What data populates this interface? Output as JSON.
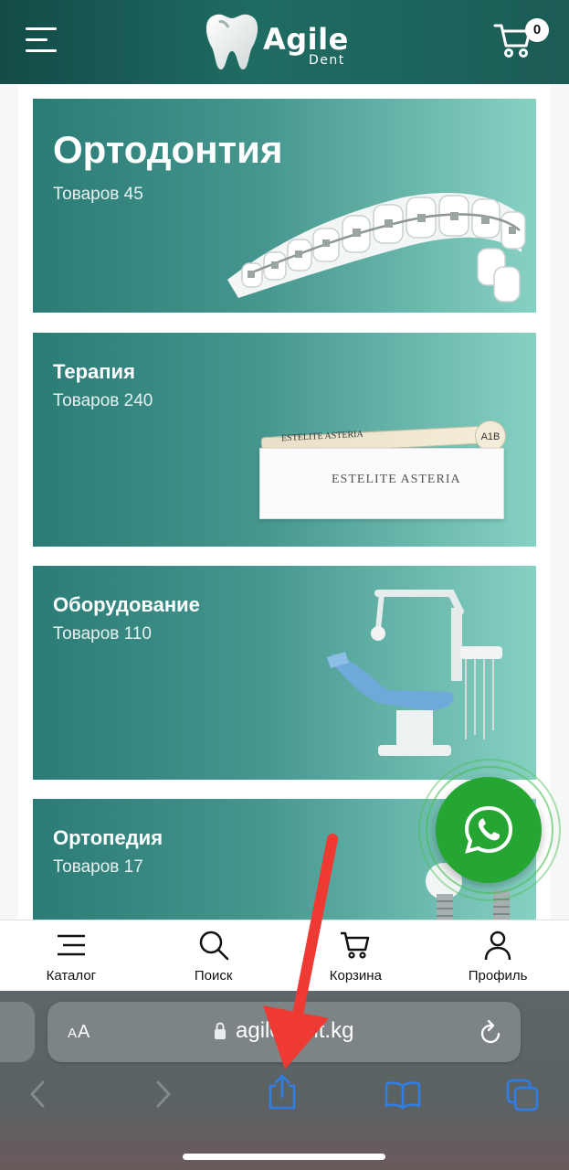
{
  "header": {
    "logo_title": "Agile",
    "logo_subtitle": "Dent",
    "cart_count": "0"
  },
  "categories": [
    {
      "title": "Ортодонтия",
      "count": "Товаров 45"
    },
    {
      "title": "Терапия",
      "count": "Товаров 240"
    },
    {
      "title": "Оборудование",
      "count": "Товаров 110"
    },
    {
      "title": "Ортопедия",
      "count": "Товаров 17"
    }
  ],
  "product_labels": {
    "syringe_brand": "ESTELITE ASTERIA",
    "syringe_shade": "A1B",
    "box_brand": "ESTELITE ASTERIA"
  },
  "bottom_nav": [
    {
      "label": "Каталог",
      "icon": "menu-icon"
    },
    {
      "label": "Поиск",
      "icon": "search-icon"
    },
    {
      "label": "Корзина",
      "icon": "cart-icon"
    },
    {
      "label": "Профиль",
      "icon": "user-icon"
    }
  ],
  "browser": {
    "text_size_label_small": "A",
    "text_size_label_big": "A",
    "url": "agiledent.kg"
  },
  "colors": {
    "header_bg": "#1b5c55",
    "card_gradient_start": "#2b7b76",
    "card_gradient_end": "#86d1c2",
    "whatsapp_green": "#25a632",
    "annotation_red": "#ee3a33",
    "browser_accent": "#2f7ee6"
  }
}
